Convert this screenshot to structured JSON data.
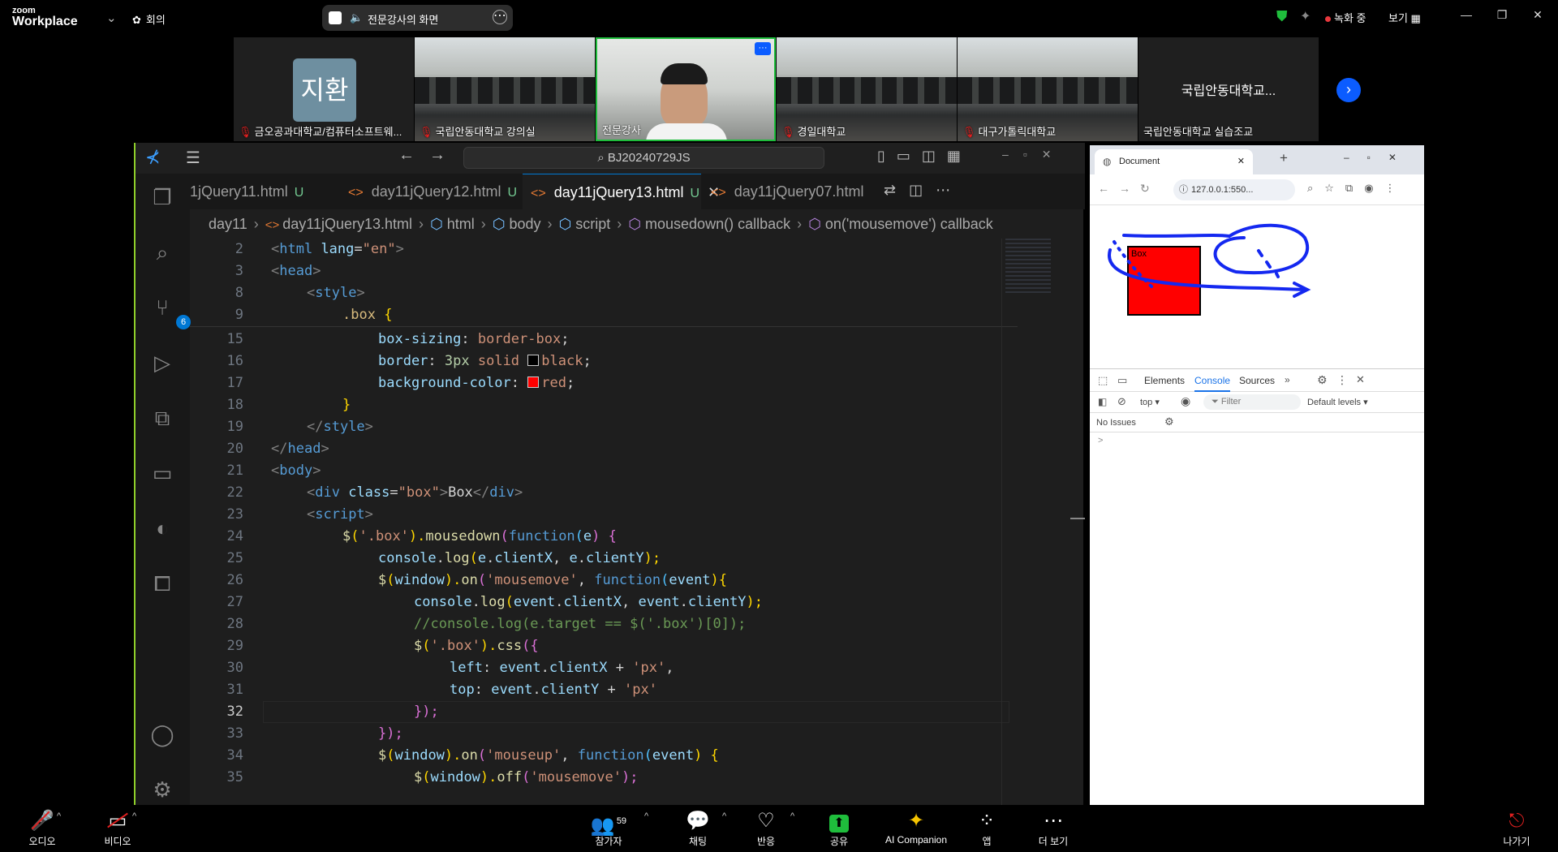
{
  "zoom": {
    "logo_line1": "zoom",
    "logo_line2": "Workplace",
    "meeting_label": "회의",
    "share_title": "전문강사의 화면",
    "recording": "녹화 중",
    "view": "보기",
    "window_minimize": "—",
    "window_restore": "❐",
    "window_close": "✕"
  },
  "gallery": [
    {
      "name": "금오공과대학교/컴퓨터소프트웨...",
      "avatar": "지환",
      "type": "avatar",
      "muted": true
    },
    {
      "name": "국립안동대학교 강의실",
      "type": "room",
      "muted": true
    },
    {
      "name": "전문강사",
      "type": "speaker",
      "muted": false,
      "menu": "···"
    },
    {
      "name": "경일대학교",
      "type": "room",
      "muted": true
    },
    {
      "name": "대구가톨릭대학교",
      "type": "room",
      "muted": true
    },
    {
      "name": "국립안동대학교 실습조교",
      "big": "국립안동대학교...",
      "type": "text",
      "muted": false
    }
  ],
  "vscode": {
    "search": "BJ20240729JS",
    "tabs": [
      {
        "label": "1jQuery11.html",
        "status": "U",
        "active": false
      },
      {
        "label": "day11jQuery12.html",
        "status": "U",
        "active": false
      },
      {
        "label": "day11jQuery13.html",
        "status": "U",
        "active": true
      },
      {
        "label": "day11jQuery07.html",
        "status": "",
        "active": false
      }
    ],
    "breadcrumbs": [
      "day11",
      "day11jQuery13.html",
      "html",
      "body",
      "script",
      "mousedown() callback",
      "on('mousemove') callback"
    ],
    "scm_badge": "6",
    "line_numbers": [
      "2",
      "3",
      "8",
      "9",
      "15",
      "16",
      "17",
      "18",
      "19",
      "20",
      "21",
      "22",
      "23",
      "24",
      "25",
      "26",
      "27",
      "28",
      "29",
      "30",
      "31",
      "32",
      "33",
      "34",
      "35"
    ],
    "current_line": "32"
  },
  "code": {
    "l2a": "<",
    "l2b": "html",
    "l2c": " lang",
    "l2d": "=",
    "l2e": "\"en\"",
    "l2f": ">",
    "l3a": "<",
    "l3b": "head",
    "l3c": ">",
    "l8a": "<",
    "l8b": "style",
    "l8c": ">",
    "l9a": ".box",
    "l9b": " {",
    "l15a": "box-sizing",
    "l15b": ": ",
    "l15c": "border-box",
    "l15d": ";",
    "l16a": "border",
    "l16b": ": ",
    "l16c": "3px",
    "l16d": " solid ",
    "l16e": "black",
    "l16f": ";",
    "l17a": "background-color",
    "l17b": ": ",
    "l17c": "red",
    "l17d": ";",
    "l18a": "}",
    "l19a": "</",
    "l19b": "style",
    "l19c": ">",
    "l20a": "</",
    "l20b": "head",
    "l20c": ">",
    "l21a": "<",
    "l21b": "body",
    "l21c": ">",
    "l22a": "<",
    "l22b": "div",
    "l22c": " class",
    "l22d": "=",
    "l22e": "\"box\"",
    "l22f": ">",
    "l22g": "Box",
    "l22h": "</",
    "l22i": "div",
    "l22j": ">",
    "l23a": "<",
    "l23b": "script",
    "l23c": ">",
    "l24a": "$",
    "l24b": "(",
    "l24c": "'.box'",
    "l24d": ").",
    "l24e": "mousedown",
    "l24f": "(",
    "l24g": "function",
    "l24h": "(",
    "l24i": "e",
    "l24j": ") {",
    "l25a": "console",
    "l25b": ".",
    "l25c": "log",
    "l25d": "(",
    "l25e": "e",
    "l25f": ".",
    "l25g": "clientX",
    "l25h": ", ",
    "l25i": "e",
    "l25j": ".",
    "l25k": "clientY",
    "l25l": ");",
    "l26a": "$",
    "l26b": "(",
    "l26c": "window",
    "l26d": ").",
    "l26e": "on",
    "l26f": "(",
    "l26g": "'mousemove'",
    "l26h": ", ",
    "l26i": "function",
    "l26j": "(",
    "l26k": "event",
    "l26l": "){",
    "l27a": "console",
    "l27b": ".",
    "l27c": "log",
    "l27d": "(",
    "l27e": "event",
    "l27f": ".",
    "l27g": "clientX",
    "l27h": ", ",
    "l27i": "event",
    "l27j": ".",
    "l27k": "clientY",
    "l27l": ");",
    "l28a": "//console.log(e.target == $('.box')[0]);",
    "l29a": "$",
    "l29b": "(",
    "l29c": "'.box'",
    "l29d": ").",
    "l29e": "css",
    "l29f": "({",
    "l30a": "left",
    "l30b": ": ",
    "l30c": "event",
    "l30d": ".",
    "l30e": "clientX",
    "l30f": " + ",
    "l30g": "'px'",
    "l30h": ",",
    "l31a": "top",
    "l31b": ": ",
    "l31c": "event",
    "l31d": ".",
    "l31e": "clientY",
    "l31f": " + ",
    "l31g": "'px'",
    "l32a": "});",
    "l33a": "});",
    "l34a": "$",
    "l34b": "(",
    "l34c": "window",
    "l34d": ").",
    "l34e": "on",
    "l34f": "(",
    "l34g": "'mouseup'",
    "l34h": ", ",
    "l34i": "function",
    "l34j": "(",
    "l34k": "event",
    "l34l": ") {",
    "l35a": "$",
    "l35b": "(",
    "l35c": "window",
    "l35d": ").",
    "l35e": "off",
    "l35f": "(",
    "l35g": "'mousemove'",
    "l35h": ");"
  },
  "browser": {
    "tab_title": "Document",
    "url": "127.0.0.1:550...",
    "box_text": "Box",
    "box_color": "#ff0000",
    "devtools": {
      "tabs": [
        "Elements",
        "Console",
        "Sources"
      ],
      "active": "Console",
      "context": "top",
      "filter": "Filter",
      "levels": "Default levels",
      "issues": "No Issues",
      "prompt": ">"
    }
  },
  "bottombar": [
    {
      "label": "오디오",
      "icon": "mic-muted-icon",
      "glyph": "🎤",
      "chevron": true
    },
    {
      "label": "비디오",
      "icon": "video-off-icon",
      "glyph": "📷",
      "chevron": true
    },
    {
      "label": "참가자",
      "icon": "participants-icon",
      "glyph": "👥",
      "count": "59",
      "chevron": true
    },
    {
      "label": "채팅",
      "icon": "chat-icon",
      "glyph": "💬",
      "chevron": true
    },
    {
      "label": "반응",
      "icon": "reaction-icon",
      "glyph": "♡",
      "chevron": true
    },
    {
      "label": "공유",
      "icon": "share-icon",
      "glyph": "⬆",
      "chevron": false
    },
    {
      "label": "AI Companion",
      "icon": "ai-companion-icon",
      "glyph": "✦",
      "chevron": false
    },
    {
      "label": "앱",
      "icon": "apps-icon",
      "glyph": "⁘",
      "chevron": false
    },
    {
      "label": "더 보기",
      "icon": "more-icon",
      "glyph": "⋯",
      "chevron": false
    },
    {
      "label": "나가기",
      "icon": "leave-icon",
      "glyph": "⎋",
      "chevron": false
    }
  ],
  "colors": {
    "zoom_accent": "#0b5cff",
    "share_green": "#1fbd3c",
    "vscode_blue": "#0078d4",
    "recording_red": "#e8383d"
  }
}
